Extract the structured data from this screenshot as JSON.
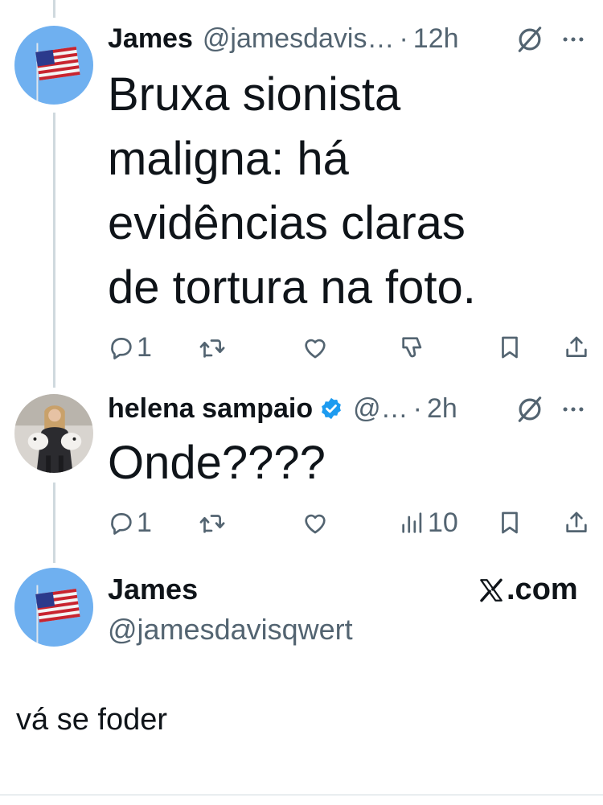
{
  "tweets": [
    {
      "name": "James",
      "handle": "@jamesdavis…",
      "dot": "·",
      "time": "12h",
      "text_lines": [
        "Bruxa sionista",
        "maligna: há",
        "evidências claras",
        "de tortura na foto."
      ],
      "replies": "1",
      "avatar_icon": "us-flag-avatar"
    },
    {
      "name": "helena sampaio",
      "handle": "@…",
      "dot": "·",
      "time": "2h",
      "text_lines": [
        "Onde????"
      ],
      "replies": "1",
      "views": "10",
      "avatar_icon": "woman-with-dogs-avatar"
    }
  ],
  "quote": {
    "name": "James",
    "handle": "@jamesdavisqwert",
    "source_label": ".com"
  },
  "reply_text": "vá se foder",
  "colors": {
    "text": "#0f1419",
    "muted": "#536471",
    "line": "#cfd9de",
    "verified": "#1d9bf0",
    "avatar_bg": "#6fb0f0"
  }
}
